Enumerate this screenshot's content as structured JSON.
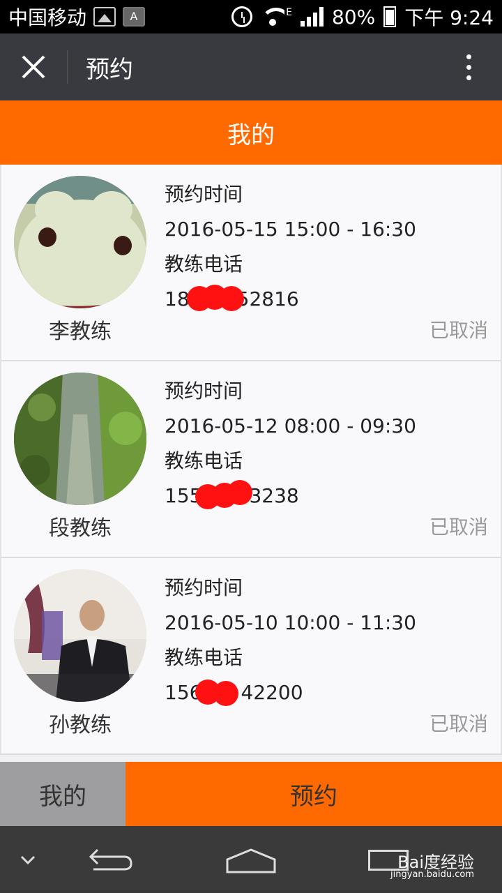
{
  "status_bar": {
    "carrier": "中国移动",
    "network_type": "E",
    "battery": "80%",
    "time": "下午 9:24"
  },
  "titlebar": {
    "title": "预约"
  },
  "header": {
    "title": "我的"
  },
  "appointments": [
    {
      "coach": "李教练",
      "time_label": "预约时间",
      "time": "2016-05-15 15:00 - 16:30",
      "phone_label": "教练电话",
      "phone_prefix": "18",
      "phone_suffix": "52816",
      "status": "已取消"
    },
    {
      "coach": "段教练",
      "time_label": "预约时间",
      "time": "2016-05-12 08:00 - 09:30",
      "phone_label": "教练电话",
      "phone_prefix": "155",
      "phone_suffix": "3238",
      "status": "已取消"
    },
    {
      "coach": "孙教练",
      "time_label": "预约时间",
      "time": "2016-05-10 10:00 - 11:30",
      "phone_label": "教练电话",
      "phone_prefix": "156",
      "phone_suffix": "42200",
      "status": "已取消"
    }
  ],
  "bottom_tabs": {
    "mine": "我的",
    "book": "预约"
  },
  "watermark": {
    "text": "Bai度经验",
    "url": "jingyan.baidu.com"
  },
  "colors": {
    "accent": "#ff6a00",
    "titlebar": "#393a3f",
    "redaction": "#ff1111"
  }
}
